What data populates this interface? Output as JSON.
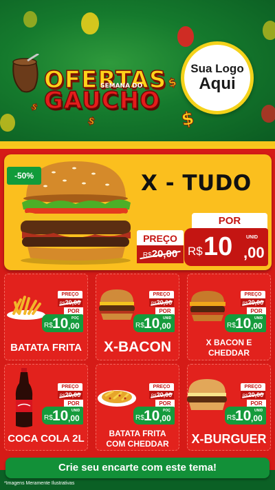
{
  "header": {
    "title_line1": "OFERTAS",
    "title_small": "SEMANA DO",
    "title_line2": "GAUCHO",
    "logo_line1": "Sua Logo",
    "logo_line2": "Aqui"
  },
  "featured": {
    "discount": "-50%",
    "name": "X - TUDO",
    "price_label": "PREÇO",
    "old_currency": "R$",
    "old_price": "20,00",
    "por_label": "POR",
    "currency": "R$",
    "price_int": "10",
    "price_cents": ",00",
    "unit": "UNID"
  },
  "products": [
    {
      "name": "BATATA FRITA",
      "preco_label": "PREÇO",
      "old_currency": "R$",
      "old_price": "20,00",
      "por_label": "POR",
      "currency": "R$",
      "price_int": "10",
      "price_cents": ",00",
      "unit": "POÇ"
    },
    {
      "name": "X-BACON",
      "preco_label": "PREÇO",
      "old_currency": "R$",
      "old_price": "20,00",
      "por_label": "POR",
      "currency": "R$",
      "price_int": "10",
      "price_cents": ",00",
      "unit": "UNID"
    },
    {
      "name": "X BACON E CHEDDAR",
      "preco_label": "PREÇO",
      "old_currency": "R$",
      "old_price": "20,00",
      "por_label": "POR",
      "currency": "R$",
      "price_int": "10",
      "price_cents": ",00",
      "unit": "UNID"
    },
    {
      "name": "COCA COLA 2L",
      "preco_label": "PREÇO",
      "old_currency": "R$",
      "old_price": "20,00",
      "por_label": "POR",
      "currency": "R$",
      "price_int": "10",
      "price_cents": ",00",
      "unit": "UNID"
    },
    {
      "name": "BATATA FRITA COM CHEDDAR",
      "preco_label": "PREÇO",
      "old_currency": "R$",
      "old_price": "20,00",
      "por_label": "POR",
      "currency": "R$",
      "price_int": "10",
      "price_cents": ",00",
      "unit": "POÇ"
    },
    {
      "name": "X-BURGUER",
      "preco_label": "PREÇO",
      "old_currency": "R$",
      "old_price": "20,00",
      "por_label": "POR",
      "currency": "R$",
      "price_int": "10",
      "price_cents": ",00",
      "unit": "UNID"
    }
  ],
  "cta_label": "Crie seu encarte com este tema!",
  "disclaimer": "*Imagens Meramente Ilustrativas",
  "colors": {
    "green": "#129038",
    "red": "#d51b17",
    "yellow": "#fbbf1e"
  }
}
